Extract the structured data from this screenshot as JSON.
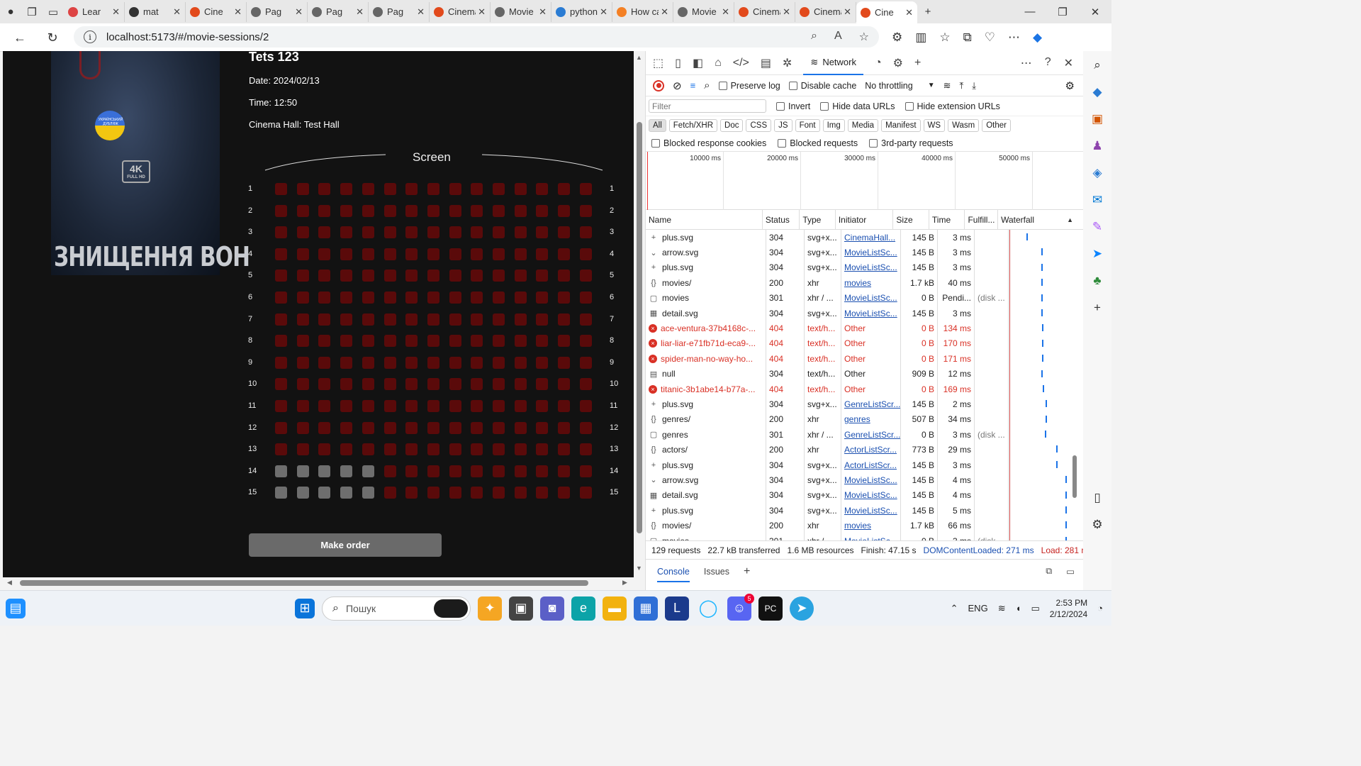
{
  "browser": {
    "tabs": [
      {
        "label": "Lear",
        "color": "#d44"
      },
      {
        "label": "mat",
        "color": "#333"
      },
      {
        "label": "Cine",
        "color": "#e24a1c"
      },
      {
        "label": "Pag",
        "color": "#666"
      },
      {
        "label": "Pag",
        "color": "#666"
      },
      {
        "label": "Pag",
        "color": "#666"
      },
      {
        "label": "Cinema S",
        "color": "#e24a1c"
      },
      {
        "label": "Movie Li",
        "color": "#666"
      },
      {
        "label": "python l",
        "color": "#2b7cd3"
      },
      {
        "label": "How can",
        "color": "#f48024"
      },
      {
        "label": "Movie Li",
        "color": "#666"
      },
      {
        "label": "Cinema",
        "color": "#e24a1c"
      },
      {
        "label": "Cinema",
        "color": "#e24a1c"
      },
      {
        "label": "Cine",
        "color": "#e24a1c",
        "active": true
      }
    ],
    "url": "localhost:5173/#/movie-sessions/2"
  },
  "session": {
    "title": "Tets 123",
    "date": "Date: 2024/02/13",
    "time": "Time: 12:50",
    "hall": "Cinema Hall: Test Hall",
    "screen_label": "Screen",
    "order_button": "Make order",
    "poster_title": "ЗНИЩЕННЯ ВОН",
    "poster_badge": "4K",
    "poster_badge_sub": "FULL HD",
    "poster_stamp": "УКРАЇНСЬКИЙ ДУБЛЯЖ",
    "rows": 15,
    "seats_per_row": 15,
    "free_seats": [
      [
        14,
        1
      ],
      [
        14,
        2
      ],
      [
        14,
        3
      ],
      [
        14,
        4
      ],
      [
        14,
        5
      ],
      [
        15,
        1
      ],
      [
        15,
        2
      ],
      [
        15,
        3
      ],
      [
        15,
        4
      ],
      [
        15,
        5
      ]
    ],
    "seat_color_taken": "#5a0a0a",
    "seat_color_free": "#6e6e6e"
  },
  "devtools": {
    "panel": "Network",
    "preserve_log": "Preserve log",
    "disable_cache": "Disable cache",
    "throttling": "No throttling",
    "filter_placeholder": "Filter",
    "invert": "Invert",
    "hide_data_urls": "Hide data URLs",
    "hide_ext_urls": "Hide extension URLs",
    "types": [
      "All",
      "Fetch/XHR",
      "Doc",
      "CSS",
      "JS",
      "Font",
      "Img",
      "Media",
      "Manifest",
      "WS",
      "Wasm",
      "Other"
    ],
    "blocked_cookies": "Blocked response cookies",
    "blocked_requests": "Blocked requests",
    "third_party": "3rd-party requests",
    "timeline_ticks": [
      "10000 ms",
      "20000 ms",
      "30000 ms",
      "40000 ms",
      "50000 ms"
    ],
    "columns": [
      "Name",
      "Status",
      "Type",
      "Initiator",
      "Size",
      "Time",
      "Fulfill...",
      "Waterfall"
    ],
    "requests": [
      {
        "icon": "+",
        "name": "plus.svg",
        "status": "304",
        "type": "svg+x...",
        "initiator": "CinemaHall...",
        "link": true,
        "size": "145 B",
        "time": "3 ms",
        "fulfill": "",
        "wf": 25
      },
      {
        "icon": "⌄",
        "name": "arrow.svg",
        "status": "304",
        "type": "svg+x...",
        "initiator": "MovieListSc...",
        "link": true,
        "size": "145 B",
        "time": "3 ms",
        "fulfill": "",
        "wf": 46
      },
      {
        "icon": "+",
        "name": "plus.svg",
        "status": "304",
        "type": "svg+x...",
        "initiator": "MovieListSc...",
        "link": true,
        "size": "145 B",
        "time": "3 ms",
        "fulfill": "",
        "wf": 46
      },
      {
        "icon": "{}",
        "name": "movies/",
        "status": "200",
        "type": "xhr",
        "initiator": "movies",
        "link": true,
        "size": "1.7 kB",
        "time": "40 ms",
        "fulfill": "",
        "wf": 46
      },
      {
        "icon": "▢",
        "name": "movies",
        "status": "301",
        "type": "xhr / ...",
        "initiator": "MovieListSc...",
        "link": true,
        "size": "0 B",
        "time": "Pendi...",
        "fulfill": "(disk ...",
        "wf": 46
      },
      {
        "icon": "▦",
        "name": "detail.svg",
        "status": "304",
        "type": "svg+x...",
        "initiator": "MovieListSc...",
        "link": true,
        "size": "145 B",
        "time": "3 ms",
        "fulfill": "",
        "wf": 46
      },
      {
        "icon": "×",
        "name": "ace-ventura-37b4168c-...",
        "status": "404",
        "type": "text/h...",
        "initiator": "Other",
        "link": false,
        "size": "0 B",
        "time": "134 ms",
        "fulfill": "",
        "wf": 47,
        "err": true
      },
      {
        "icon": "×",
        "name": "liar-liar-e71fb71d-eca9-...",
        "status": "404",
        "type": "text/h...",
        "initiator": "Other",
        "link": false,
        "size": "0 B",
        "time": "170 ms",
        "fulfill": "",
        "wf": 47,
        "err": true
      },
      {
        "icon": "×",
        "name": "spider-man-no-way-ho...",
        "status": "404",
        "type": "text/h...",
        "initiator": "Other",
        "link": false,
        "size": "0 B",
        "time": "171 ms",
        "fulfill": "",
        "wf": 47,
        "err": true
      },
      {
        "icon": "▤",
        "name": "null",
        "status": "304",
        "type": "text/h...",
        "initiator": "Other",
        "link": false,
        "size": "909 B",
        "time": "12 ms",
        "fulfill": "",
        "wf": 46
      },
      {
        "icon": "×",
        "name": "titanic-3b1abe14-b77a-...",
        "status": "404",
        "type": "text/h...",
        "initiator": "Other",
        "link": false,
        "size": "0 B",
        "time": "169 ms",
        "fulfill": "",
        "wf": 48,
        "err": true
      },
      {
        "icon": "+",
        "name": "plus.svg",
        "status": "304",
        "type": "svg+x...",
        "initiator": "GenreListScr...",
        "link": true,
        "size": "145 B",
        "time": "2 ms",
        "fulfill": "",
        "wf": 52
      },
      {
        "icon": "{}",
        "name": "genres/",
        "status": "200",
        "type": "xhr",
        "initiator": "genres",
        "link": true,
        "size": "507 B",
        "time": "34 ms",
        "fulfill": "",
        "wf": 52
      },
      {
        "icon": "▢",
        "name": "genres",
        "status": "301",
        "type": "xhr / ...",
        "initiator": "GenreListScr...",
        "link": true,
        "size": "0 B",
        "time": "3 ms",
        "fulfill": "(disk ...",
        "wf": 51
      },
      {
        "icon": "{}",
        "name": "actors/",
        "status": "200",
        "type": "xhr",
        "initiator": "ActorListScr...",
        "link": true,
        "size": "773 B",
        "time": "29 ms",
        "fulfill": "",
        "wf": 67
      },
      {
        "icon": "+",
        "name": "plus.svg",
        "status": "304",
        "type": "svg+x...",
        "initiator": "ActorListScr...",
        "link": true,
        "size": "145 B",
        "time": "3 ms",
        "fulfill": "",
        "wf": 67
      },
      {
        "icon": "⌄",
        "name": "arrow.svg",
        "status": "304",
        "type": "svg+x...",
        "initiator": "MovieListSc...",
        "link": true,
        "size": "145 B",
        "time": "4 ms",
        "fulfill": "",
        "wf": 80
      },
      {
        "icon": "▦",
        "name": "detail.svg",
        "status": "304",
        "type": "svg+x...",
        "initiator": "MovieListSc...",
        "link": true,
        "size": "145 B",
        "time": "4 ms",
        "fulfill": "",
        "wf": 80
      },
      {
        "icon": "+",
        "name": "plus.svg",
        "status": "304",
        "type": "svg+x...",
        "initiator": "MovieListSc...",
        "link": true,
        "size": "145 B",
        "time": "5 ms",
        "fulfill": "",
        "wf": 80
      },
      {
        "icon": "{}",
        "name": "movies/",
        "status": "200",
        "type": "xhr",
        "initiator": "movies",
        "link": true,
        "size": "1.7 kB",
        "time": "66 ms",
        "fulfill": "",
        "wf": 80
      },
      {
        "icon": "▢",
        "name": "movies",
        "status": "301",
        "type": "xhr / ...",
        "initiator": "MovieListSc...",
        "link": true,
        "size": "0 B",
        "time": "3 ms",
        "fulfill": "(disk ...",
        "wf": 80
      }
    ],
    "status_bar": {
      "requests": "129 requests",
      "transferred": "22.7 kB transferred",
      "resources": "1.6 MB resources",
      "finish": "Finish: 47.15 s",
      "dcl": "DOMContentLoaded: 271 ms",
      "load": "Load: 281 ms"
    },
    "drawer_tabs": [
      "Console",
      "Issues"
    ]
  },
  "taskbar": {
    "search_placeholder": "Пошук",
    "lang": "ENG",
    "time": "2:53 PM",
    "date": "2/12/2024",
    "discord_badge": "5"
  }
}
